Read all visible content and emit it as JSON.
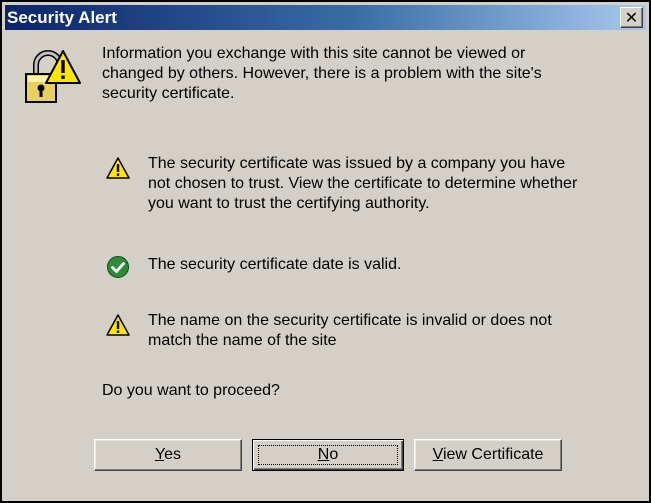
{
  "window": {
    "title": "Security Alert"
  },
  "icons": {
    "lock": "lock-warning-icon",
    "warning": "warning-triangle-icon",
    "ok": "check-circle-icon",
    "colors": {
      "title_start": "#0a246a",
      "title_end": "#a6caf0",
      "warning_fill": "#ffe600",
      "ok_fill": "#2e8b3a",
      "face": "#d4d0c8"
    }
  },
  "intro": {
    "line1": "Information you exchange with this site cannot be viewed or",
    "line2": "changed by others. However, there is a problem with the site's",
    "line3": "security certificate."
  },
  "items": [
    {
      "status": "warning",
      "line1": "The security certificate was issued by a company you have",
      "line2": "not chosen to trust. View the certificate to determine whether",
      "line3": "you want to trust the certifying authority."
    },
    {
      "status": "ok",
      "line1": "The security certificate date is valid."
    },
    {
      "status": "warning",
      "line1": "The name on the security certificate is invalid or does not",
      "line2": "match the name of the site"
    }
  ],
  "question": "Do you want to proceed?",
  "buttons": {
    "yes": {
      "mnemonic": "Y",
      "rest": "es"
    },
    "no": {
      "mnemonic": "N",
      "rest": "o"
    },
    "view": {
      "mnemonic": "V",
      "rest": "iew Certificate"
    }
  }
}
